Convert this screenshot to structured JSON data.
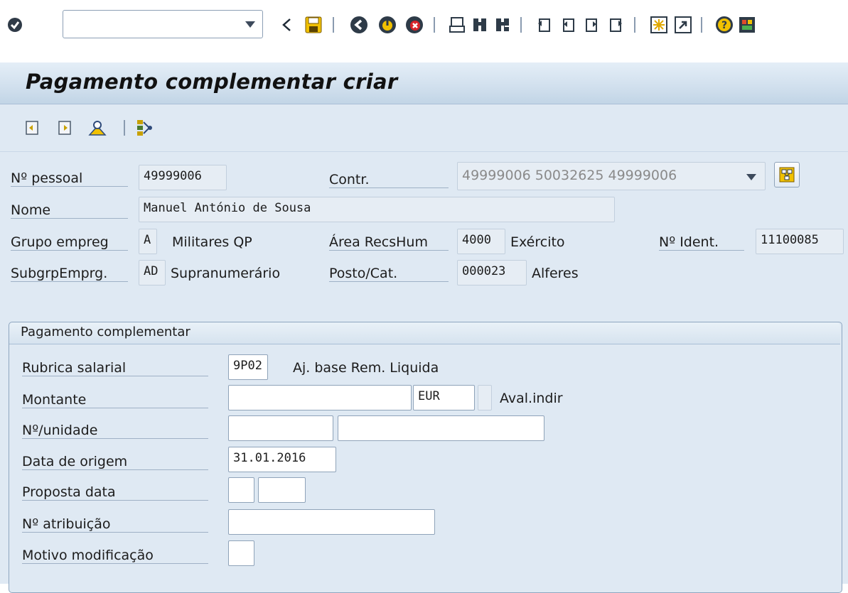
{
  "toolbar": {
    "command_field_value": "",
    "icons": [
      "enter-icon",
      "back-arrow-icon",
      "save-icon",
      "back-icon",
      "exit-icon",
      "cancel-icon",
      "print-icon",
      "find-icon",
      "find-next-icon",
      "first-page-icon",
      "previous-page-icon",
      "next-page-icon",
      "last-page-icon",
      "create-session-icon",
      "shortcut-icon",
      "help-icon",
      "customize-layout-icon"
    ]
  },
  "title": "Pagamento complementar criar",
  "app_toolbar": {
    "icons": [
      "previous-record-icon",
      "next-record-icon",
      "person-overview-icon",
      "org-structure-icon"
    ]
  },
  "header": {
    "personnel_no": {
      "label": "Nº pessoal",
      "value": "49999006"
    },
    "contract": {
      "label": "Contr.",
      "value": "49999006 50032625 49999006"
    },
    "name": {
      "label": "Nome",
      "value": "Manuel António de Sousa"
    },
    "employee_group": {
      "label": "Grupo empreg",
      "code": "A",
      "text": "Militares QP"
    },
    "personnel_area": {
      "label": "Área RecsHum",
      "code": "4000",
      "text": "Exército"
    },
    "id_no": {
      "label": "Nº Ident.",
      "value": "11100085"
    },
    "employee_subgroup": {
      "label": "SubgrpEmprg.",
      "code": "AD",
      "text": "Supranumerário"
    },
    "post": {
      "label": "Posto/Cat.",
      "code": "000023",
      "text": "Alferes"
    }
  },
  "group": {
    "title": "Pagamento complementar",
    "wage_type": {
      "label": "Rubrica salarial",
      "value": "9P02",
      "text": "Aj. base Rem. Liquida"
    },
    "amount": {
      "label": "Montante",
      "value": "",
      "currency": "EUR",
      "indirect_flag": "",
      "indirect_label": "Aval.indir"
    },
    "number_unit": {
      "label": "Nº/unidade",
      "value": "",
      "unit": ""
    },
    "origin_date": {
      "label": "Data de origem",
      "value": "31.01.2016"
    },
    "default_date": {
      "label": "Proposta data",
      "value1": "",
      "value2": ""
    },
    "assignment_no": {
      "label": "Nº atribuição",
      "value": ""
    },
    "reason": {
      "label": "Motivo modificação",
      "value": ""
    }
  }
}
